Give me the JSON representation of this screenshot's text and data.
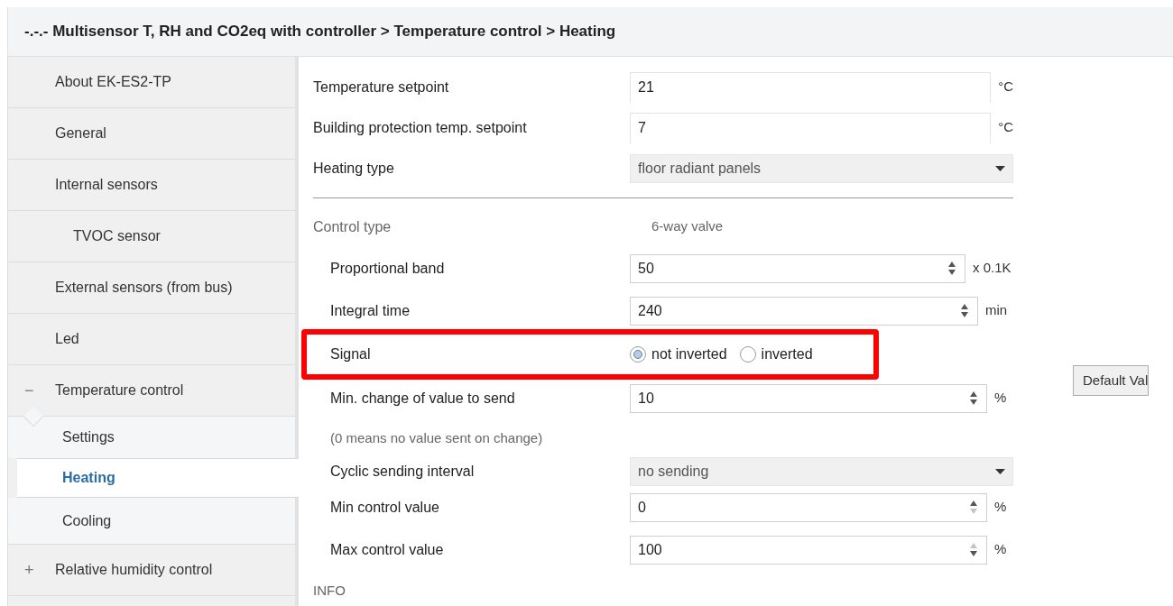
{
  "breadcrumb": "-.-.- Multisensor T, RH and CO2eq with controller > Temperature control > Heating",
  "sidebar": {
    "items": [
      {
        "label": "About EK-ES2-TP",
        "selected": false
      },
      {
        "label": "General",
        "selected": false
      },
      {
        "label": "Internal sensors",
        "selected": false,
        "children": [
          {
            "label": "TVOC sensor",
            "selected": false
          }
        ]
      },
      {
        "label": "External sensors (from bus)",
        "selected": false
      },
      {
        "label": "Led",
        "selected": false
      },
      {
        "label": "Temperature control",
        "selected": false,
        "toggle": "−",
        "expanded": true,
        "children": [
          {
            "label": "Settings",
            "selected": false
          },
          {
            "label": "Heating",
            "selected": true
          },
          {
            "label": "Cooling",
            "selected": false
          }
        ]
      },
      {
        "label": "Relative humidity control",
        "selected": false,
        "toggle": "+",
        "expanded": false
      }
    ]
  },
  "parameters": [
    {
      "kind": "text",
      "label": "Temperature setpoint",
      "value": "21",
      "unit": "°C"
    },
    {
      "kind": "text",
      "label": "Building protection temp. setpoint",
      "value": "7",
      "unit": "°C"
    },
    {
      "kind": "dropdown",
      "label": "Heating type",
      "value": "floor radiant panels"
    },
    {
      "kind": "divider"
    },
    {
      "kind": "static",
      "label": "Control type",
      "value": "6-way valve",
      "children": [
        {
          "kind": "spin",
          "label": "Proportional band",
          "value": "50",
          "unit": "x 0.1K",
          "up_disabled": false,
          "down_disabled": false
        },
        {
          "kind": "spin",
          "label": "Integral time",
          "value": "240",
          "unit": "min",
          "up_disabled": false,
          "down_disabled": false
        },
        {
          "kind": "radio",
          "label": "Signal",
          "highlighted": true,
          "options": [
            {
              "label": "not inverted",
              "selected": true
            },
            {
              "label": "inverted",
              "selected": false
            }
          ]
        },
        {
          "kind": "spin",
          "label": "Min. change of value to send",
          "value": "10",
          "unit": "%",
          "up_disabled": false,
          "down_disabled": false
        },
        {
          "kind": "note",
          "label": "(0 means no value sent on change)"
        },
        {
          "kind": "dropdown",
          "label": "Cyclic sending interval",
          "value": "no sending"
        },
        {
          "kind": "spin",
          "label": "Min control value",
          "value": "0",
          "unit": "%",
          "up_disabled": false,
          "down_disabled": true
        },
        {
          "kind": "spin",
          "label": "Max control value",
          "value": "100",
          "unit": "%",
          "up_disabled": true,
          "down_disabled": false
        }
      ]
    },
    {
      "kind": "section",
      "label": "INFO"
    }
  ],
  "default_button": "Default Val"
}
